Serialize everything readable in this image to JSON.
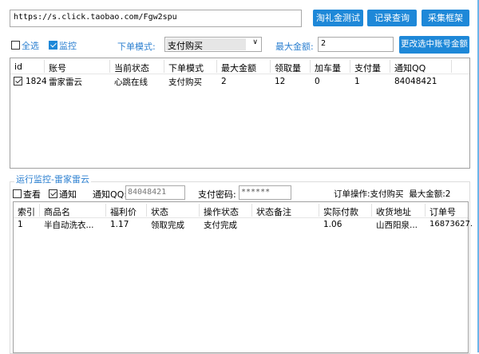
{
  "top": {
    "url": "https://s.click.taobao.com/Fgw2spu",
    "buttons": [
      "淘礼金测试",
      "记录查询",
      "采集框架"
    ]
  },
  "controls": {
    "select_all": "全选",
    "select_all_checked": false,
    "monitor": "监控",
    "monitor_checked": true,
    "mode_label": "下单模式:",
    "mode_value": "支付购买",
    "max_label": "最大金额:",
    "max_value": "2",
    "change_button": "更改选中账号金额"
  },
  "accounts": {
    "columns": [
      "id",
      "账号",
      "当前状态",
      "下单模式",
      "最大金额",
      "领取量",
      "加车量",
      "支付量",
      "通知QQ"
    ],
    "rows": [
      {
        "checked": true,
        "cells": [
          "1824",
          "雷家雷云",
          "心跳在线",
          "支付购买",
          "2",
          "12",
          "0",
          "1",
          "84048421"
        ]
      }
    ]
  },
  "monitor": {
    "title": "运行监控-雷家雷云",
    "view": "查看",
    "view_checked": false,
    "notify": "通知",
    "notify_checked": true,
    "qq_label": "通知QQ:",
    "qq_value": "84048421",
    "pwd_label": "支付密码:",
    "pwd_value": "******",
    "order_info": "订单操作:支付购买  最大金额:2"
  },
  "orders": {
    "columns": [
      "索引",
      "商品名",
      "福利价",
      "状态",
      "操作状态",
      "状态备注",
      "实际付款",
      "收货地址",
      "订单号"
    ],
    "rows": [
      [
        "1",
        "半自动洗衣...",
        "1.17",
        "领取完成",
        "支付完成",
        "",
        "1.06",
        "山西阳泉...",
        "16873627."
      ]
    ]
  },
  "colors": {
    "accent": "#1e88d8",
    "label": "#2b7fd0"
  }
}
